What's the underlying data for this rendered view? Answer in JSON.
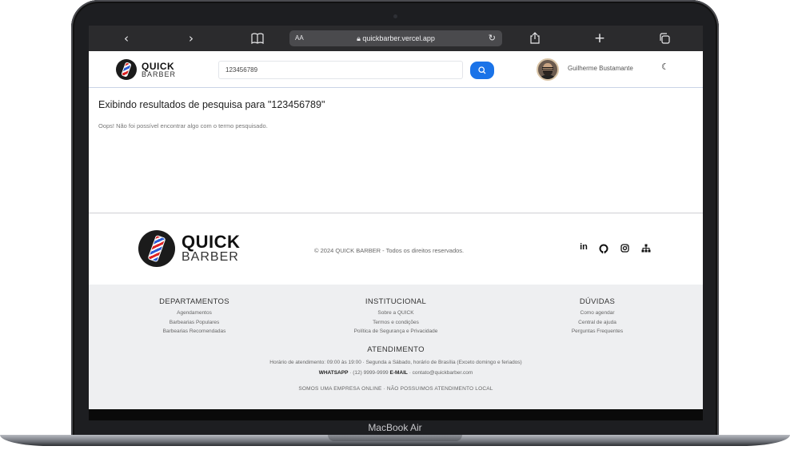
{
  "browser": {
    "back_icon": "chevron-left-icon",
    "forward_icon": "chevron-right-icon",
    "bookmarks_icon": "book-icon",
    "reader_label": "AA",
    "url": "quickbarber.vercel.app",
    "share_icon": "share-icon",
    "new_tab_icon": "plus-icon",
    "tabs_icon": "tabs-icon"
  },
  "header": {
    "brand_top": "QUICK",
    "brand_bottom": "BARBER",
    "search_value": "123456789",
    "search_icon": "search-icon",
    "user_name": "Guilherme Bustamante",
    "theme_icon": "moon-icon"
  },
  "main": {
    "results_title": "Exibindo resultados de pesquisa para \"123456789\"",
    "empty_message": "Oops! Não foi possível encontrar algo com o termo pesquisado."
  },
  "footer": {
    "brand_top": "QUICK",
    "brand_bottom": "BARBER",
    "copyright": "© 2024 QUICK BARBER - Todos os direitos reservados.",
    "social": [
      "in",
      "",
      "",
      ""
    ],
    "columns": [
      {
        "title": "DEPARTAMENTOS",
        "links": [
          "Agendamentos",
          "Barbearias Populares",
          "Barbearias Recomendadas"
        ]
      },
      {
        "title": "INSTITUCIONAL",
        "links": [
          "Sobre a QUICK",
          "Termos e condições",
          "Política de Segurança e Privacidade"
        ]
      },
      {
        "title": "DÚVIDAS",
        "links": [
          "Como agendar",
          "Central de ajuda",
          "Perguntas Frequentes"
        ]
      }
    ],
    "attendance": {
      "title": "ATENDIMENTO",
      "hours": "Horário de atendimento: 09:00 às 19:00 · Segunda a Sábado, horário de Brasília (Exceto domingo e feriados)",
      "whatsapp_label": "WHATSAPP",
      "whatsapp_value": "(12) 9999-9999",
      "email_label": "E-MAIL",
      "email_value": "contato@quickbarber.com",
      "online_notice": "SOMOS UMA EMPRESA ONLINE · NÃO POSSUIMOS ATENDIMENTO LOCAL"
    }
  },
  "device": {
    "model": "MacBook Air"
  },
  "colors": {
    "accent": "#1a73e8",
    "safari_bar": "#2b2b2d",
    "footer_bg": "#eeeff1"
  }
}
